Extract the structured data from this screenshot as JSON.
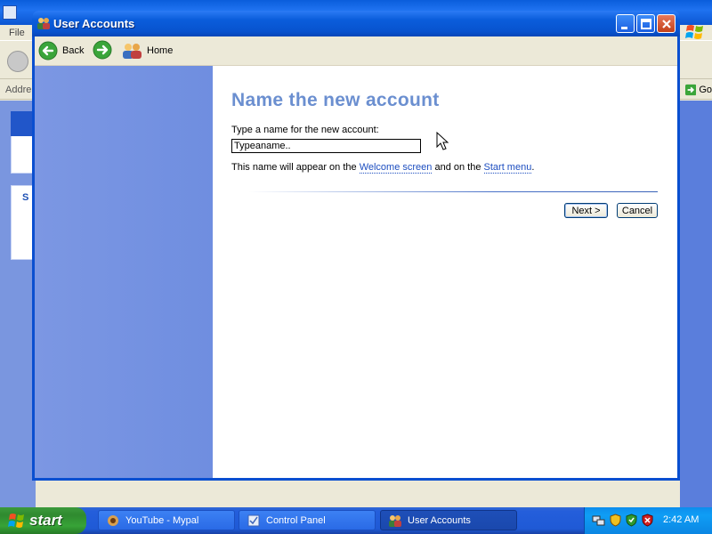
{
  "background_window": {
    "menu_file": "File",
    "address_label": "Addre",
    "go_label": "Go",
    "task_heading_partial": "S"
  },
  "window": {
    "title": "User Accounts"
  },
  "navbar": {
    "back_label": "Back",
    "home_label": "Home"
  },
  "content": {
    "page_title": "Name the new account",
    "prompt": "Type a name for the new account:",
    "input_value": "Typeaname..",
    "info_prefix": "This name will appear on the ",
    "link_welcome": "Welcome screen",
    "info_middle": " and on the ",
    "link_start_menu": "Start menu",
    "info_suffix": ".",
    "next_button": "Next >",
    "cancel_button": "Cancel"
  },
  "taskbar": {
    "start_label": "start",
    "tasks": [
      {
        "label": "YouTube - Mypal",
        "icon": "browser-icon"
      },
      {
        "label": "Control Panel",
        "icon": "control-panel-icon"
      },
      {
        "label": "User Accounts",
        "icon": "user-accounts-icon",
        "active": true
      }
    ],
    "clock": "2:42 AM"
  },
  "colors": {
    "title_accent": "#6b8fd0",
    "link": "#1d4ec0",
    "sidepane": "#7c97e3",
    "taskbar": "#245edb",
    "start_green": "#37a337"
  }
}
